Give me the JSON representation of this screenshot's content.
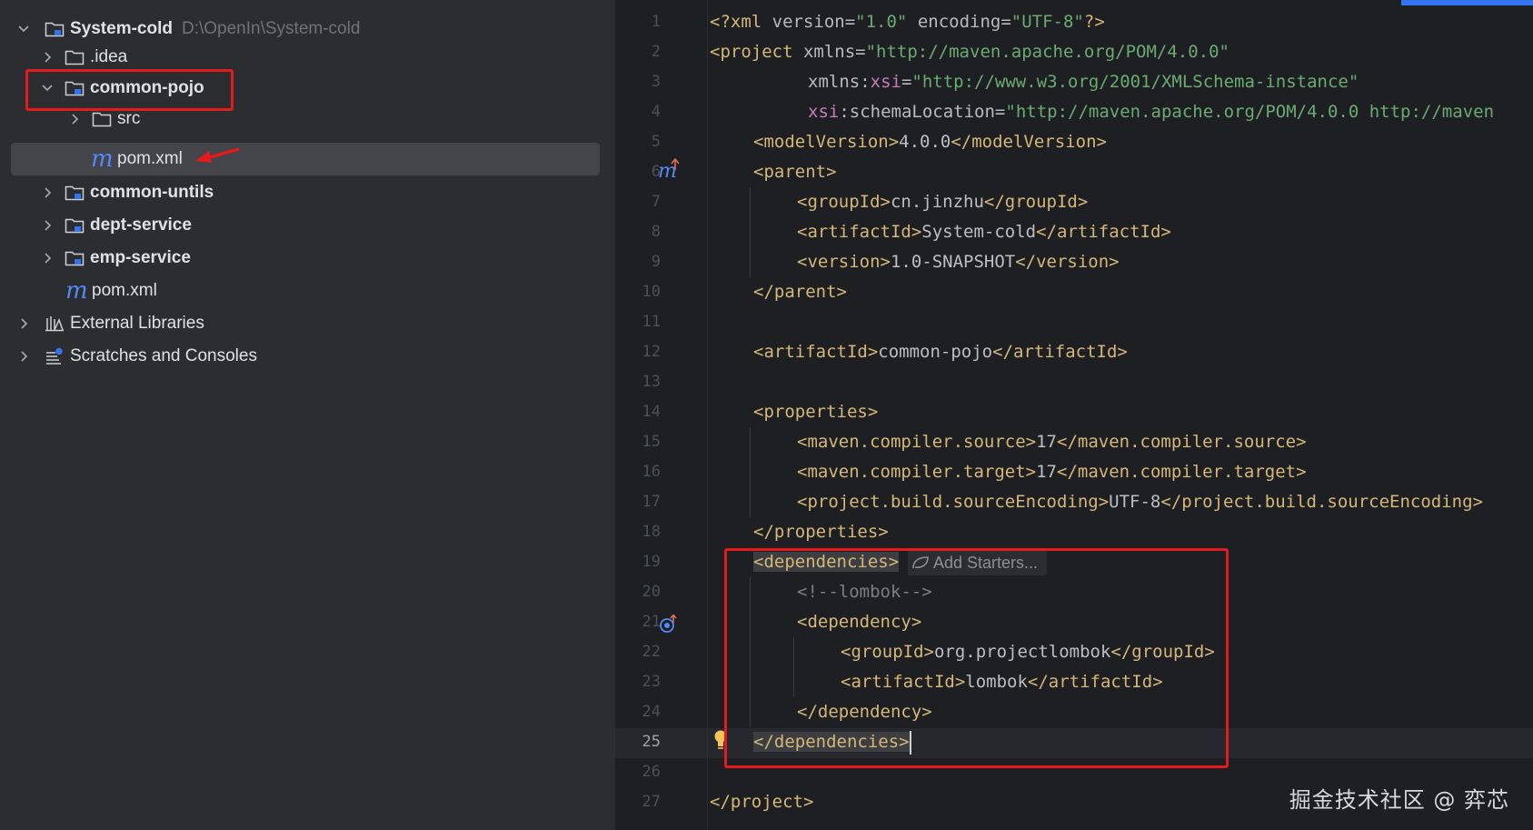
{
  "tree": {
    "root": {
      "name": "System-cold",
      "path": "D:\\OpenIn\\System-cold"
    },
    "idea": ".idea",
    "common_pojo": "common-pojo",
    "src": "src",
    "pom_selected": "pom.xml",
    "common_untils": "common-untils",
    "dept_service": "dept-service",
    "emp_service": "emp-service",
    "pom_root": "pom.xml",
    "external_libraries": "External Libraries",
    "scratches": "Scratches and Consoles"
  },
  "editor": {
    "line_numbers": [
      "1",
      "2",
      "3",
      "4",
      "5",
      "6",
      "7",
      "8",
      "9",
      "10",
      "11",
      "12",
      "13",
      "14",
      "15",
      "16",
      "17",
      "18",
      "19",
      "20",
      "21",
      "22",
      "23",
      "24",
      "25",
      "26",
      "27"
    ],
    "hint": "Add Starters...",
    "l1": {
      "a": "<?xml ",
      "b": "version",
      "c": "=",
      "d": "\"1.0\"",
      "e": " ",
      "f": "encoding",
      "g": "=",
      "h": "\"UTF-8\"",
      "i": "?>"
    },
    "l2": {
      "a": "<project ",
      "b": "xmlns",
      "c": "=",
      "d": "\"http://maven.apache.org/POM/4.0.0\""
    },
    "l3": {
      "a": "xmlns:",
      "b": "xsi",
      "c": "=",
      "d": "\"http://www.w3.org/2001/XMLSchema-instance\""
    },
    "l4": {
      "a": "xsi",
      "b": ":schemaLocation",
      "c": "=",
      "d": "\"http://maven.apache.org/POM/4.0.0 http://maven"
    },
    "l5": {
      "a": "<modelVersion>",
      "b": "4.0.0",
      "c": "</modelVersion>"
    },
    "l6": "<parent>",
    "l7": {
      "a": "<groupId>",
      "b": "cn.jinzhu",
      "c": "</groupId>"
    },
    "l8": {
      "a": "<artifactId>",
      "b": "System-cold",
      "c": "</artifactId>"
    },
    "l9": {
      "a": "<version>",
      "b": "1.0-SNAPSHOT",
      "c": "</version>"
    },
    "l10": "</parent>",
    "l12": {
      "a": "<artifactId>",
      "b": "common-pojo",
      "c": "</artifactId>"
    },
    "l14": "<properties>",
    "l15": {
      "a": "<maven.compiler.source>",
      "b": "17",
      "c": "</maven.compiler.source>"
    },
    "l16": {
      "a": "<maven.compiler.target>",
      "b": "17",
      "c": "</maven.compiler.target>"
    },
    "l17": {
      "a": "<project.build.sourceEncoding>",
      "b": "UTF-8",
      "c": "</project.build.sourceEncoding>"
    },
    "l18": "</properties>",
    "l19": "<dependencies>",
    "l20": "<!--lombok-->",
    "l21": "<dependency>",
    "l22": {
      "a": "<groupId>",
      "b": "org.projectlombok",
      "c": "</groupId>"
    },
    "l23": {
      "a": "<artifactId>",
      "b": "lombok",
      "c": "</artifactId>"
    },
    "l24": "</dependency>",
    "l25": "</dependencies>",
    "l27": "</project>",
    "gutter_marker_6": "m",
    "current_line": "25"
  },
  "watermark": "掘金技术社区 @ 弈芯",
  "colors": {
    "tag": "#d5b778",
    "value": "#6aab73",
    "namespace": "#c77dbb",
    "annotation": "#e31b1b",
    "accent": "#548af7"
  }
}
